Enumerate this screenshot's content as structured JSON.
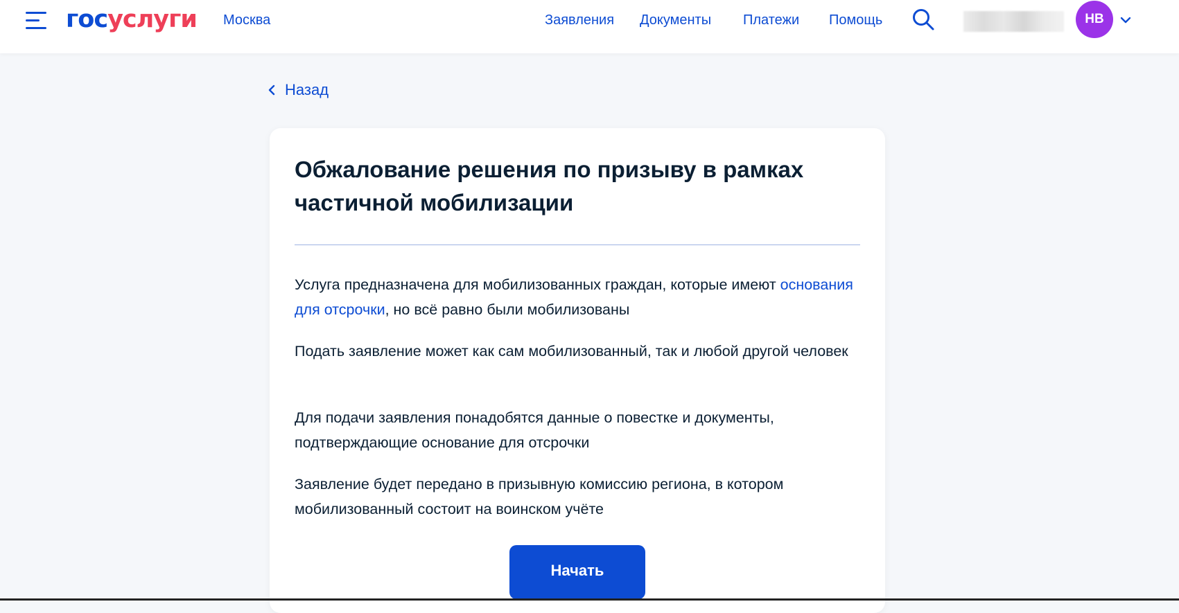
{
  "header": {
    "logo_part1": "гос",
    "logo_part2": "услуги",
    "city": "Москва",
    "nav": [
      "Заявления",
      "Документы",
      "Платежи",
      "Помощь"
    ],
    "user_name": "",
    "avatar_initials": "НВ",
    "icons": {
      "menu": "burger-menu-icon",
      "search": "search-icon",
      "dropdown": "chevron-down-icon"
    }
  },
  "back": {
    "label": "Назад",
    "icon": "chevron-left-icon"
  },
  "card": {
    "title": "Обжалование решения по призыву в рамках частичной мобилизации",
    "p1_before_link": "Услуга предназначена для мобилизованных граждан, которые имеют ",
    "p1_link": "основания для отсрочки",
    "p1_after_link": ", но всё равно были мобилизованы",
    "p2": "Подать заявление может как сам мобилизованный, так и любой другой человек",
    "p3": "Для подачи заявления понадобятся данные о повестке и документы, подтверждающие основание для отсрочки",
    "p4": "Заявление будет передано в призывную комиссию региона, в котором мобилизованный состоит на воинском учёте",
    "start_label": "Начать"
  },
  "colors": {
    "brand_blue": "#0d4cd3",
    "brand_red": "#ee3f58",
    "avatar_purple": "#9b33e8",
    "page_bg": "#f5f7fa",
    "text_dark": "#0b1f33"
  }
}
